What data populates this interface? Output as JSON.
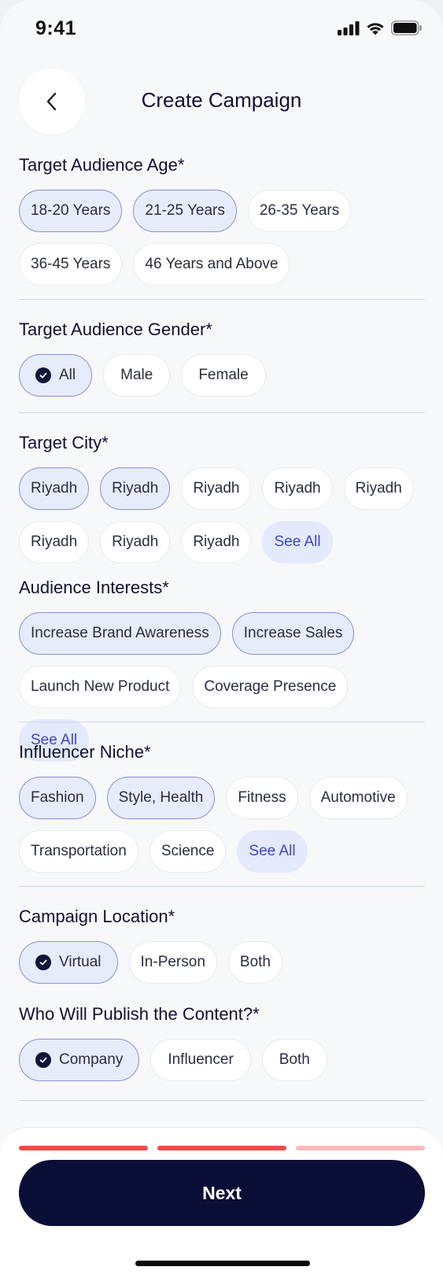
{
  "status_bar": {
    "time": "9:41"
  },
  "header": {
    "title": "Create Campaign",
    "back_icon": "chevron-left-icon"
  },
  "age": {
    "title": "Target Audience Age*",
    "options": [
      {
        "label": "18-20 Years",
        "selected": true
      },
      {
        "label": "21-25 Years",
        "selected": true
      },
      {
        "label": "26-35 Years",
        "selected": false
      },
      {
        "label": "36-45 Years",
        "selected": false
      },
      {
        "label": "46 Years and Above",
        "selected": false
      }
    ]
  },
  "gender": {
    "title": "Target Audience Gender*",
    "options": [
      {
        "label": "All",
        "selected": true
      },
      {
        "label": "Male",
        "selected": false
      },
      {
        "label": "Female",
        "selected": false
      }
    ]
  },
  "city": {
    "title": "Target City*",
    "options": [
      {
        "label": "Riyadh",
        "selected": true
      },
      {
        "label": "Riyadh",
        "selected": true
      },
      {
        "label": "Riyadh",
        "selected": false
      },
      {
        "label": "Riyadh",
        "selected": false
      },
      {
        "label": "Riyadh",
        "selected": false
      },
      {
        "label": "Riyadh",
        "selected": false
      },
      {
        "label": "Riyadh",
        "selected": false
      },
      {
        "label": "Riyadh",
        "selected": false
      }
    ],
    "see_all": "See All"
  },
  "interests": {
    "title": "Audience Interests*",
    "options": [
      {
        "label": "Increase Brand Awareness",
        "selected": true
      },
      {
        "label": "Increase Sales",
        "selected": true
      },
      {
        "label": "Launch New Product",
        "selected": false
      },
      {
        "label": "Coverage Presence",
        "selected": false
      }
    ],
    "see_all": "See All"
  },
  "niche": {
    "title": "Influencer Niche*",
    "options": [
      {
        "label": "Fashion",
        "selected": true
      },
      {
        "label": "Style, Health",
        "selected": true
      },
      {
        "label": "Fitness",
        "selected": false
      },
      {
        "label": "Automotive",
        "selected": false
      },
      {
        "label": "Transportation",
        "selected": false
      },
      {
        "label": "Science",
        "selected": false
      }
    ],
    "see_all": "See All"
  },
  "location": {
    "title": "Campaign Location*",
    "options": [
      {
        "label": "Virtual",
        "selected": true
      },
      {
        "label": "In-Person",
        "selected": false
      },
      {
        "label": "Both",
        "selected": false
      }
    ]
  },
  "publisher": {
    "title": "Who Will Publish the Content?*",
    "options": [
      {
        "label": "Company",
        "selected": true
      },
      {
        "label": "Influencer",
        "selected": false
      },
      {
        "label": "Both",
        "selected": false
      }
    ]
  },
  "progress": {
    "steps_total": 3,
    "steps_done": 2,
    "active_color": "#f04a47",
    "inactive_color": "#f8bcbd"
  },
  "footer": {
    "next_label": "Next"
  },
  "colors": {
    "accent": "#0b0e36",
    "selected_bg": "#e7ecfb",
    "selected_border": "#8790d8",
    "link": "#3e45c6"
  }
}
